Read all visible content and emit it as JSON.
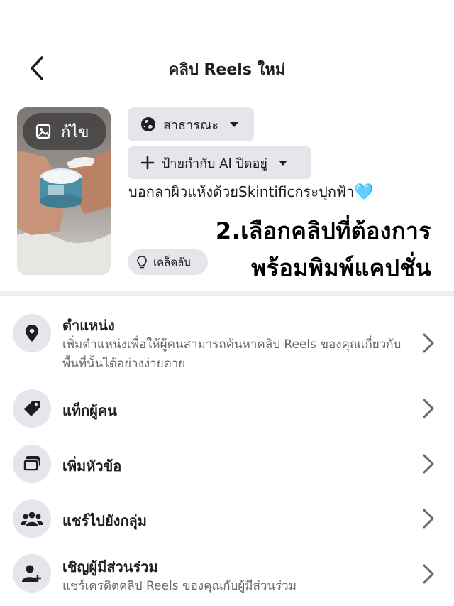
{
  "header": {
    "title": "คลิป Reels ใหม่"
  },
  "media": {
    "edit_label": "ก้ไข"
  },
  "audience": {
    "label": "สาธารณะ"
  },
  "ai_label": {
    "label": "ป้ายกำกับ AI ปิดอยู่"
  },
  "caption": {
    "text": "บอกลาผิวแห้งด้วยSkintificกระปุกฟ้า",
    "emoji": "🩵"
  },
  "tips": {
    "label": "เคล็ดลับ"
  },
  "overlay": {
    "line1": "2.เลือกคลิปที่ต้องการ",
    "line2": "พร้อมพิมพ์แคปชั่น"
  },
  "options": [
    {
      "title": "ตำแหน่ง",
      "desc": "เพิ่มตำแหน่งเพื่อให้ผู้คนสามารถค้นหาคลิป Reels ของคุณเกี่ยวกับพื้นที่นั้นได้อย่างง่ายดาย",
      "icon": "location-pin-icon"
    },
    {
      "title": "แท็กผู้คน",
      "desc": "",
      "icon": "tag-icon"
    },
    {
      "title": "เพิ่มหัวข้อ",
      "desc": "",
      "icon": "topics-icon"
    },
    {
      "title": "แชร์ไปยังกลุ่ม",
      "desc": "",
      "icon": "groups-icon"
    },
    {
      "title": "เชิญผู้มีส่วนร่วม",
      "desc": "แชร์เครดิตคลิป Reels ของคุณกับผู้มีส่วนร่วม",
      "icon": "add-person-icon"
    }
  ]
}
